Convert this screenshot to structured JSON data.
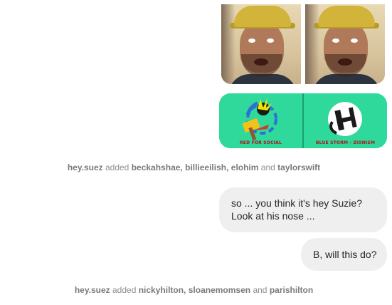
{
  "thread": {
    "messages": [
      {
        "type": "photo_set",
        "from": "me"
      },
      {
        "type": "graphic",
        "from": "me",
        "captions": [
          "RED FOR SOCIAL",
          "BLUE STORM - ZIONISM"
        ]
      },
      {
        "type": "event",
        "actor": "hey.suez",
        "verb": "added",
        "names": "beckahshae, billieeilish, elohim",
        "conjunction": "and",
        "last_name": "taylorswift"
      },
      {
        "type": "text",
        "from": "me",
        "text": "so ... you think it's hey Suzie? Look at his nose ..."
      },
      {
        "type": "text",
        "from": "me",
        "text": "B, will this do?"
      },
      {
        "type": "event",
        "actor": "hey.suez",
        "verb": "added",
        "names": "nickyhilton, sloanemomsen",
        "conjunction": "and",
        "last_name": "parishilton"
      }
    ]
  },
  "colors": {
    "bubble_bg": "#efefef",
    "event_text": "#8e8e8e",
    "graphic_bg": "#2fd89b",
    "graphic_caption": "#b3121b"
  },
  "icons": {
    "graphic_left": "hammer-sickle-icon",
    "graphic_right": "hand-symbol-icon"
  }
}
